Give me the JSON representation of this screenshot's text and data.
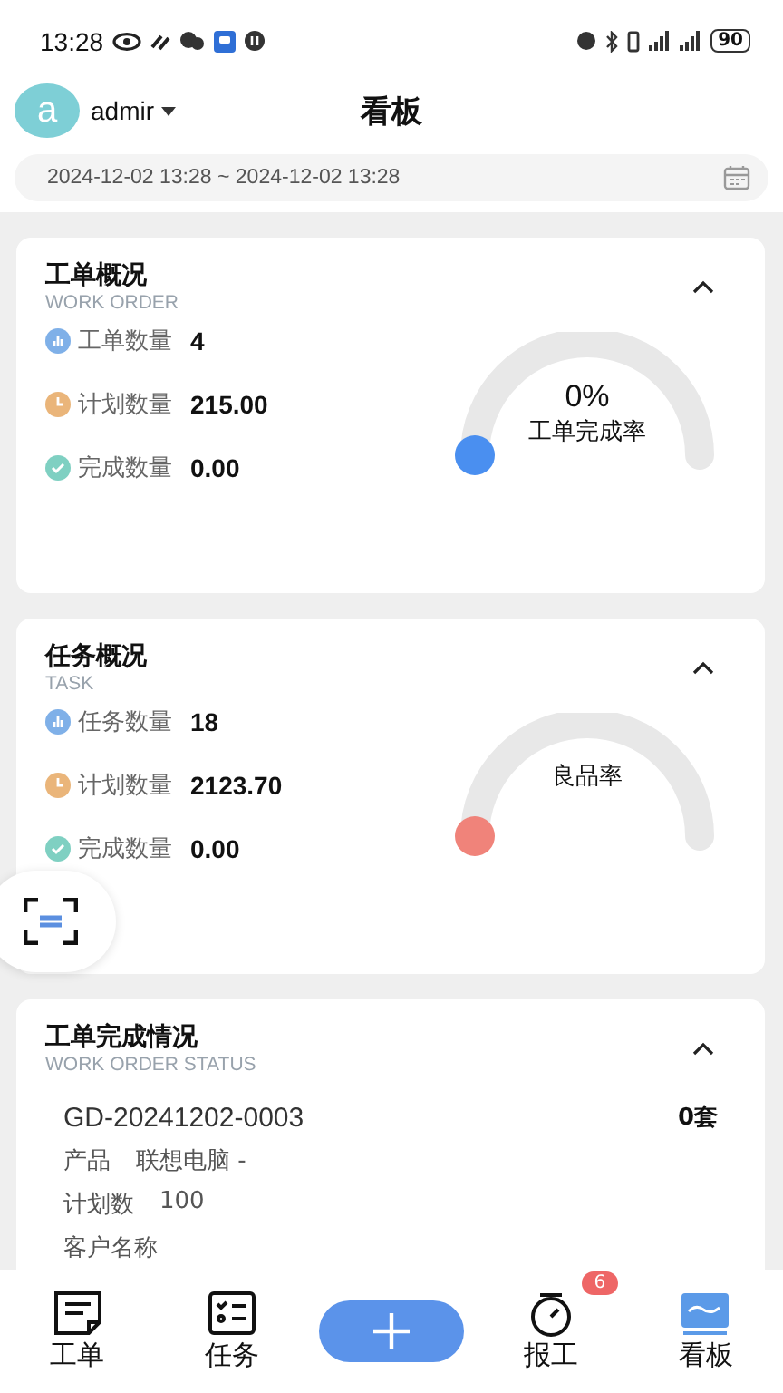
{
  "status_bar": {
    "time": "13:28",
    "battery": "90"
  },
  "header": {
    "avatar": "a",
    "user": "admir",
    "title": "看板"
  },
  "date_range": {
    "value": "2024-12-02 13:28 ~ 2024-12-02 13:28"
  },
  "overview_cards": [
    {
      "title": "工单概况",
      "subtitle": "WORK ORDER",
      "expanded": true,
      "stats": [
        {
          "kind": "count",
          "label": "工单数量",
          "value": "4"
        },
        {
          "kind": "plan",
          "label": "计划数量",
          "value": "215.00"
        },
        {
          "kind": "done",
          "label": "完成数量",
          "value": "0.00"
        }
      ],
      "gauge": {
        "percent": "0%",
        "label": "工单完成率",
        "color": "#4a8ff0"
      }
    },
    {
      "title": "任务概况",
      "subtitle": "TASK",
      "expanded": true,
      "stats": [
        {
          "kind": "count",
          "label": "任务数量",
          "value": "18"
        },
        {
          "kind": "plan",
          "label": "计划数量",
          "value": "2123.70"
        },
        {
          "kind": "done",
          "label": "完成数量",
          "value": "0.00"
        }
      ],
      "gauge": {
        "label": "良品率",
        "color": "#f0837a"
      }
    }
  ],
  "status_card": {
    "title": "工单完成情况",
    "subtitle": "WORK ORDER STATUS",
    "expanded": true,
    "orders": [
      {
        "code": "GD-20241202-0003",
        "quantity": "0套",
        "fields": [
          {
            "label": "产品",
            "value": "联想电脑 -"
          },
          {
            "label": "计划数",
            "value": "100"
          },
          {
            "label": "客户名称"
          }
        ]
      }
    ]
  },
  "bottom_nav": [
    {
      "kind": "order",
      "label": "工单",
      "selected": false
    },
    {
      "kind": "task",
      "label": "任务",
      "selected": false
    },
    {
      "kind": "add",
      "selected": false
    },
    {
      "kind": "report",
      "label": "报工",
      "selected": false,
      "badge": "6"
    },
    {
      "kind": "board",
      "label": "看板",
      "selected": true
    }
  ]
}
